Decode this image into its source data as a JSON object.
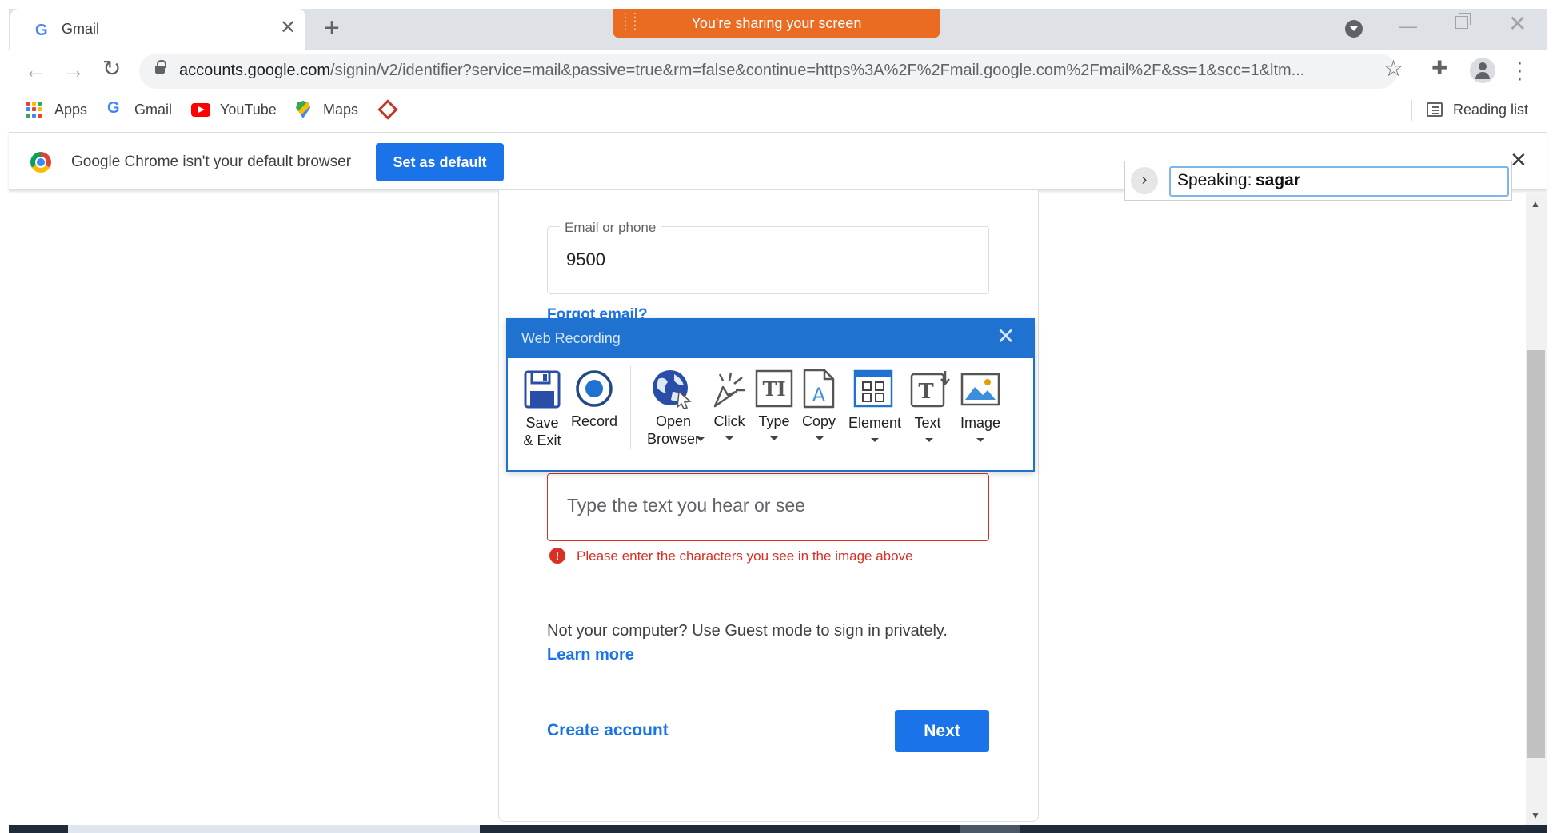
{
  "browser": {
    "tab_title": "Gmail",
    "share_banner": "You're sharing your screen",
    "url_host": "accounts.google.com",
    "url_rest": "/signin/v2/identifier?service=mail&passive=true&rm=false&continue=https%3A%2F%2Fmail.google.com%2Fmail%2F&ss=1&scc=1&ltm...",
    "bookmarks": [
      {
        "label": "Apps",
        "icon": "apps-grid-icon"
      },
      {
        "label": "Gmail",
        "icon": "google-g-icon"
      },
      {
        "label": "YouTube",
        "icon": "youtube-icon"
      },
      {
        "label": "Maps",
        "icon": "maps-icon"
      }
    ],
    "reading_list": "Reading list"
  },
  "infobar": {
    "message": "Google Chrome isn't your default browser",
    "button": "Set as default"
  },
  "speaking": {
    "prefix": "Speaking:",
    "name": "sagar"
  },
  "signin": {
    "email_label": "Email or phone",
    "email_value": "9500",
    "forgot_email": "Forgot email?",
    "captcha_placeholder": "Type the text you hear or see",
    "error": "Please enter the characters you see in the image above",
    "guest_text": "Not your computer? Use Guest mode to sign in privately.",
    "learn_more": "Learn more",
    "create_account": "Create account",
    "next": "Next"
  },
  "recorder": {
    "title": "Web Recording",
    "tools": [
      {
        "label": "Save\n& Exit",
        "icon": "save-icon"
      },
      {
        "label": "Record",
        "icon": "record-icon"
      },
      {
        "label": "Open\nBrowser",
        "icon": "globe-icon"
      },
      {
        "label": "Click",
        "icon": "click-icon"
      },
      {
        "label": "Type",
        "icon": "type-icon"
      },
      {
        "label": "Copy",
        "icon": "copy-icon"
      },
      {
        "label": "Element",
        "icon": "element-icon"
      },
      {
        "label": "Text",
        "icon": "text-icon"
      },
      {
        "label": "Image",
        "icon": "image-icon"
      }
    ]
  },
  "colors": {
    "accent": "#1a73e8",
    "error": "#d93025",
    "share_banner": "#ea6c22",
    "recorder_title": "#1f72cf"
  }
}
